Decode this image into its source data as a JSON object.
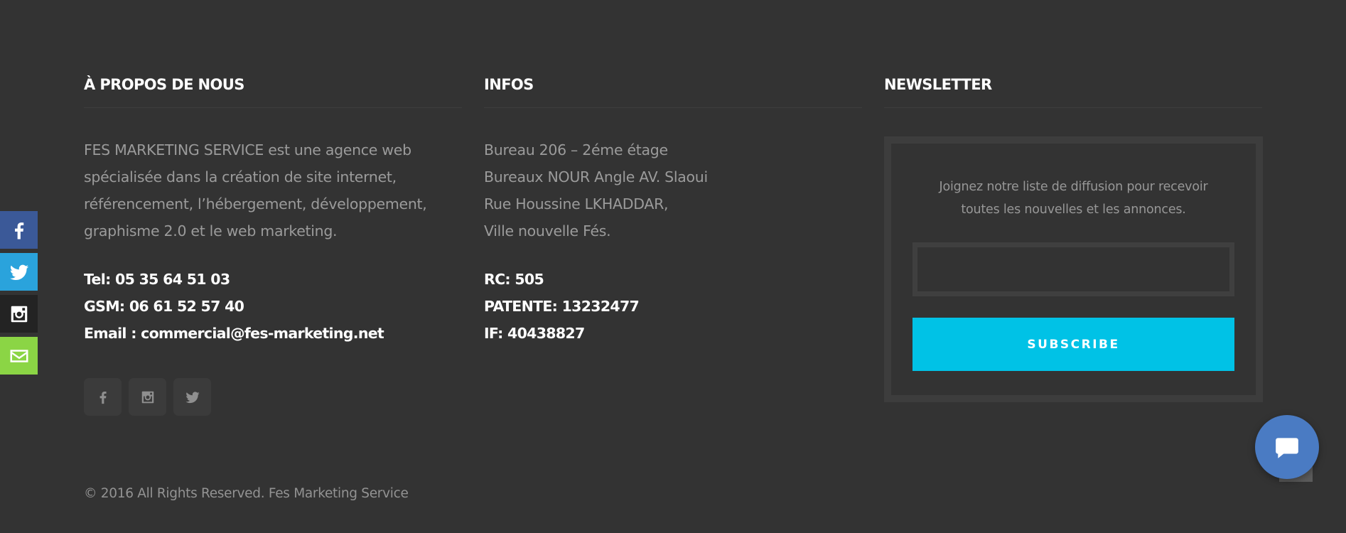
{
  "about": {
    "title": "À PROPOS DE NOUS",
    "description_lines": [
      "FES MARKETING SERVICE est une agence web",
      "spécialisée dans la création de site internet,",
      "référencement, l’hébergement, développement,",
      "graphisme 2.0 et le web marketing."
    ],
    "contact_lines": [
      "Tel: 05 35 64 51 03",
      "GSM: 06 61 52 57 40",
      "Email : commercial@fes-marketing.net"
    ],
    "social_icons": [
      "facebook-icon",
      "instagram-icon",
      "twitter-icon"
    ]
  },
  "infos": {
    "title": "INFOS",
    "address_lines": [
      "Bureau 206 – 2éme étage",
      "Bureaux NOUR Angle AV. Slaoui",
      "Rue Houssine LKHADDAR,",
      "Ville nouvelle Fés."
    ],
    "legal_lines": [
      "RC: 505",
      "PATENTE: 13232477",
      "IF: 40438827"
    ]
  },
  "newsletter": {
    "title": "NEWSLETTER",
    "text_lines": [
      "Joignez notre liste de diffusion pour recevoir",
      "toutes les nouvelles et les annonces."
    ],
    "email_value": "",
    "subscribe_label": "SUBSCRIBE"
  },
  "footer": {
    "copyright": "© 2016 All Rights Reserved. Fes Marketing Service"
  },
  "side_share": {
    "items": [
      "facebook-icon",
      "twitter-icon",
      "instagram-icon",
      "mail-icon"
    ],
    "colors": {
      "facebook": "#3b5998",
      "twitter": "#2aa3dc",
      "instagram": "#232323",
      "mail": "#8bd545"
    }
  },
  "colors": {
    "background": "#333333",
    "accent": "#00c2e6",
    "chat": "#4a7bc3"
  }
}
